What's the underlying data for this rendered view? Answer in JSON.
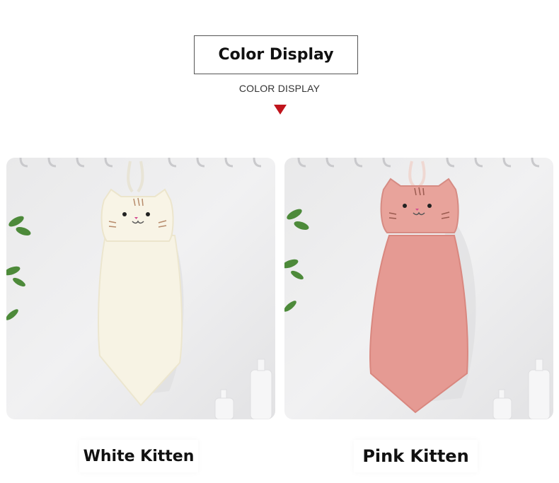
{
  "header": {
    "title": "Color Display",
    "subtitle": "COLOR DISPLAY",
    "arrow_icon": "triangle-down-icon",
    "arrow_color": "#c0141c"
  },
  "products": [
    {
      "caption": "White Kitten",
      "towel_color": "#f7f3e4",
      "icon": "kitten-towel-icon"
    },
    {
      "caption": "Pink Kitten",
      "towel_color": "#e59a93",
      "icon": "kitten-towel-icon"
    }
  ]
}
